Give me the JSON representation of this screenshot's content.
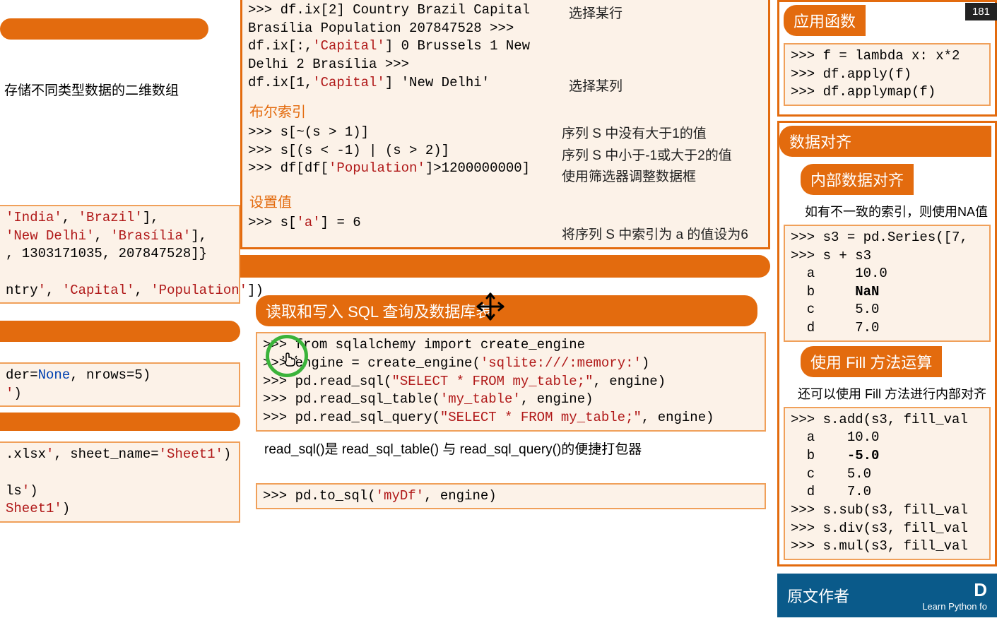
{
  "left": {
    "hdr1_blank": "",
    "desc_2d": "存储不同类型数据的二维数组",
    "code_frag1": "'India', 'Brazil'],\n'New Delhi', 'Brasília'],\n, 1303171035, 207847528]}",
    "code_frag2": "ntry', 'Capital', 'Population'])",
    "code_frag3": "der=None, nrows=5)\n')",
    "code_frag4": ".xlsx', sheet_name='Sheet1')",
    "code_frag5": "ls')\nSheet1')"
  },
  "mid_top": {
    "ix2_prompt": ">>> df.ix[2]",
    "ix2_out": "  Country      Brazil\n  Capital    Brasília\n  Population  207847528",
    "sel_row": "选择某行",
    "ixcol_prompt": ">>> df.ix[:,'Capital']",
    "ixcol_out": "  0     Brussels\n  1    New Delhi\n  2     Brasília",
    "sel_col": "选择某列",
    "ix1cap_prompt": ">>> df.ix[1,'Capital']",
    "ix1cap_out": "  'New Delhi'",
    "bool_hdr": "布尔索引",
    "bool1": ">>> s[~(s > 1)]",
    "bool1_note": "序列 S 中没有大于1的值",
    "bool2": ">>> s[(s < -1) | (s > 2)]",
    "bool2_note": "序列 S 中小于-1或大于2的值",
    "bool3": ">>> df[df['Population']>1200000000]",
    "bool3_note": "使用筛选器调整数据框",
    "set_hdr": "设置值",
    "set1": ">>> s['a'] = 6",
    "set1_note": "将序列 S 中索引为 a 的值设为6"
  },
  "sql": {
    "header": "读取和写入 SQL 查询及数据库表",
    "code1": ">>> from sqlalchemy import create_engine\n>>> engine = create_engine('sqlite:///:memory:')\n>>> pd.read_sql(\"SELECT * FROM my_table;\", engine)\n>>> pd.read_sql_table('my_table', engine)\n>>> pd.read_sql_query(\"SELECT * FROM my_table;\", engine)",
    "note": "read_sql()是 read_sql_table() 与 read_sql_query()的便捷打包器",
    "code2": ">>> pd.to_sql('myDf', engine)"
  },
  "right": {
    "apply_hdr": "应用函数",
    "apply_code": ">>> f = lambda x: x*2\n>>> df.apply(f)\n>>> df.applymap(f)",
    "align_hdr": "数据对齐",
    "align_sub": "内部数据对齐",
    "align_note": "如有不一致的索引，则使用NA值",
    "align_code": ">>> s3 = pd.Series([7, \n>>> s + s3\n  a     10.0\n  b     NaN\n  c     5.0\n  d     7.0",
    "fill_hdr": "使用 Fill 方法运算",
    "fill_note": "还可以使用 Fill 方法进行内部对齐",
    "fill_code": ">>> s.add(s3, fill_val\n  a    10.0\n  b    -5.0\n  c    5.0\n  d    7.0\n>>> s.sub(s3, fill_val\n>>> s.div(s3, fill_val\n>>> s.mul(s3, fill_val",
    "author_hdr": "原文作者",
    "author_sub1": "D",
    "author_sub2": "Learn Python fo"
  },
  "badge": "181"
}
